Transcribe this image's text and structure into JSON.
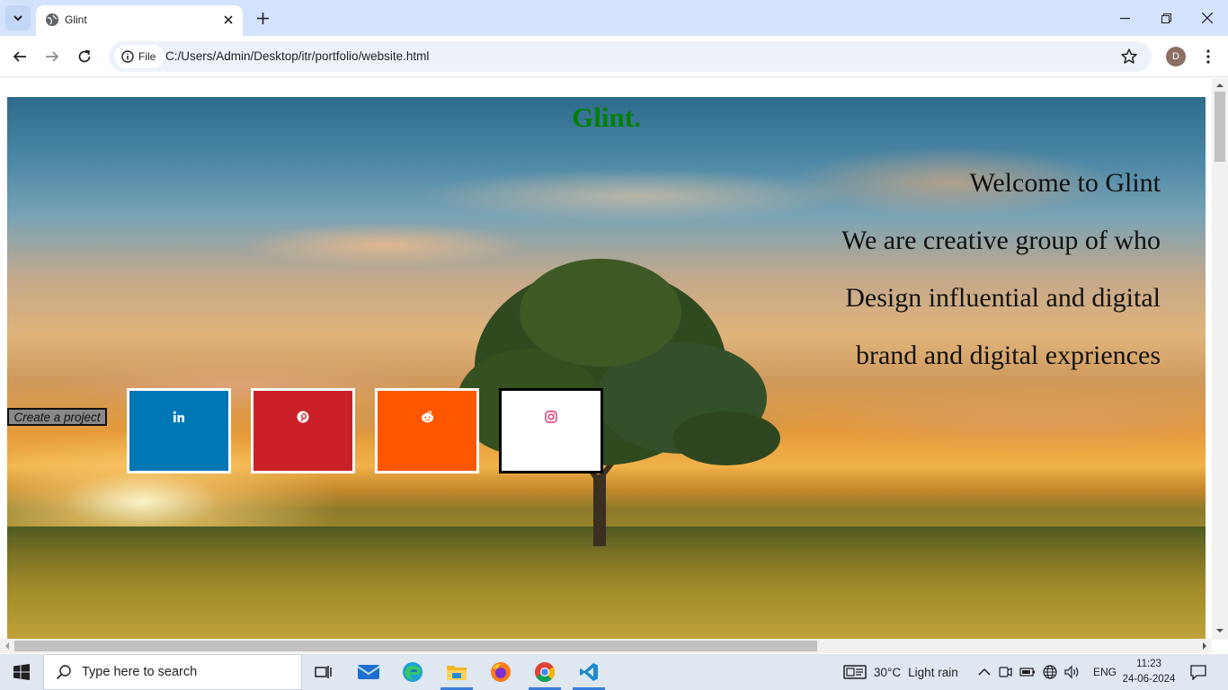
{
  "browser": {
    "tab": {
      "title": "Glint",
      "favicon": "globe-icon",
      "close_icon": "close-icon"
    },
    "new_tab_icon": "plus-icon",
    "tab_search_icon": "chevron-down-icon",
    "window_controls": [
      "minimize-icon",
      "restore-icon",
      "close-icon"
    ],
    "toolbar": {
      "back_icon": "arrow-left-icon",
      "forward_icon": "arrow-right-icon",
      "reload_icon": "reload-icon",
      "site_info_label": "File",
      "url": "C:/Users/Admin/Desktop/itr/portfolio/website.html",
      "bookmark_icon": "star-icon",
      "profile_initial": "D",
      "menu_icon": "kebab-menu-icon"
    }
  },
  "page": {
    "brand": "Glint.",
    "intro_lines": [
      "Welcome to Glint",
      "We are creative group of who",
      "Design influential and digital",
      "brand and digital expriences"
    ],
    "create_project_label": "Create a project",
    "social": [
      {
        "name": "linkedin",
        "icon": "linkedin-icon",
        "color": "#0077b5"
      },
      {
        "name": "pinterest",
        "icon": "pinterest-icon",
        "color": "#cb2027"
      },
      {
        "name": "reddit",
        "icon": "reddit-icon",
        "color": "#ff5700"
      },
      {
        "name": "instagram",
        "icon": "instagram-icon",
        "color": "#ffffff"
      }
    ],
    "brand_color": "#008000"
  },
  "taskbar": {
    "search_placeholder": "Type here to search",
    "apps": [
      "task-view-icon",
      "mail-icon",
      "edge-icon",
      "file-explorer-icon",
      "firefox-icon",
      "chrome-icon",
      "vscode-icon"
    ],
    "weather_temp": "30°C",
    "weather_desc": "Light rain",
    "language": "ENG",
    "time": "11:23",
    "date": "24-06-2024"
  }
}
